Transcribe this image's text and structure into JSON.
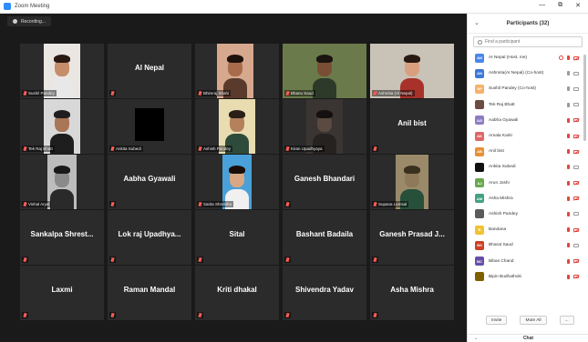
{
  "window": {
    "title": "Zoom Meeting",
    "controls": [
      "—",
      "⧉",
      "✕"
    ]
  },
  "recording": {
    "label": "Recording..."
  },
  "tiles": [
    {
      "name": "Sushil Pandey",
      "kind": "video"
    },
    {
      "name": "Al Nepal",
      "kind": "name"
    },
    {
      "name": "Bhimraj Shahi",
      "kind": "video"
    },
    {
      "name": "Bhanu Saud",
      "kind": "video"
    },
    {
      "name": "Ashmita (Al Nepal)",
      "kind": "video",
      "active": true
    },
    {
      "name": "Tek Raj Bhatt",
      "kind": "video"
    },
    {
      "name": "Ankita Subedi",
      "kind": "video"
    },
    {
      "name": "Ashish Pandey",
      "kind": "video"
    },
    {
      "name": "Kiran Upadhyaya",
      "kind": "video"
    },
    {
      "name": "Anil bist",
      "kind": "name"
    },
    {
      "name": "Vishal Aryal",
      "kind": "video"
    },
    {
      "name": "Aabha Gyawali",
      "kind": "name"
    },
    {
      "name": "Sarita Shrestha",
      "kind": "video"
    },
    {
      "name": "Ganesh Bhandari",
      "kind": "name"
    },
    {
      "name": "Supana Lamsal",
      "kind": "video"
    },
    {
      "name": "Sankalpa Shrest...",
      "kind": "name"
    },
    {
      "name": "Lok raj Upadhya...",
      "kind": "name"
    },
    {
      "name": "Sital",
      "kind": "name"
    },
    {
      "name": "Bashant Badaila",
      "kind": "name"
    },
    {
      "name": "Ganesh Prasad J...",
      "kind": "name"
    },
    {
      "name": "Laxmi",
      "kind": "name"
    },
    {
      "name": "Raman Mandal",
      "kind": "name"
    },
    {
      "name": "Kriti dhakal",
      "kind": "name"
    },
    {
      "name": "Shivendra Yadav",
      "kind": "name"
    },
    {
      "name": "Asha Mishra",
      "kind": "name"
    }
  ],
  "participants_panel": {
    "title": "Participants (32)",
    "search_placeholder": "Find a participant",
    "participants": [
      {
        "initials": "AN",
        "name": "AI Nepal (Host, me)",
        "color": "#4a86e8",
        "mic": "off",
        "video": "off",
        "share": true
      },
      {
        "initials": "AN",
        "name": "Ashmita(AI Nepal) (Co-host)",
        "color": "#3c78d8",
        "mic": "on",
        "video": "on"
      },
      {
        "initials": "SP",
        "name": "Sushil Pandey (Co-host)",
        "color": "#f6b26b",
        "mic": "on",
        "video": "on"
      },
      {
        "initials": "",
        "name": "Tek Raj Bhatt",
        "color": "#6d4c41",
        "mic": "on",
        "video": "on"
      },
      {
        "initials": "AG",
        "name": "Aabha Gyawali",
        "color": "#8e7cc3",
        "mic": "off",
        "video": "off"
      },
      {
        "initials": "AK",
        "name": "Amala Karki",
        "color": "#e06666",
        "mic": "off",
        "video": "off"
      },
      {
        "initials": "AB",
        "name": "Anil bist",
        "color": "#e69138",
        "mic": "off",
        "video": "off"
      },
      {
        "initials": "",
        "name": "Ankita Subedi",
        "color": "#111111",
        "mic": "off",
        "video": "on"
      },
      {
        "initials": "AJ",
        "name": "Arun Joshi",
        "color": "#6aa84f",
        "mic": "off",
        "video": "off"
      },
      {
        "initials": "AM",
        "name": "Asha Mishra",
        "color": "#45a085",
        "mic": "off",
        "video": "off"
      },
      {
        "initials": "",
        "name": "Ashish Pandey",
        "color": "#5b5b5b",
        "mic": "off",
        "video": "on"
      },
      {
        "initials": "B",
        "name": "Bandana",
        "color": "#f1c232",
        "mic": "off",
        "video": "off"
      },
      {
        "initials": "BS",
        "name": "Bharat Saud",
        "color": "#cc4125",
        "mic": "off",
        "video": "on"
      },
      {
        "initials": "BC",
        "name": "Bibas Chand",
        "color": "#674ea7",
        "mic": "off",
        "video": "off"
      },
      {
        "initials": "",
        "name": "Bipin Budhathoki",
        "color": "#7f6000",
        "mic": "off",
        "video": "off"
      }
    ],
    "footer": {
      "invite": "Invite",
      "mute_all": "Mute All",
      "more": "..."
    }
  },
  "chat": {
    "title": "Chat"
  },
  "colors": {
    "active_speaker": "#b4e63c",
    "muted": "#e0463f",
    "tile_bg": "#2b2b2b",
    "page_bg": "#1a1a1a"
  }
}
